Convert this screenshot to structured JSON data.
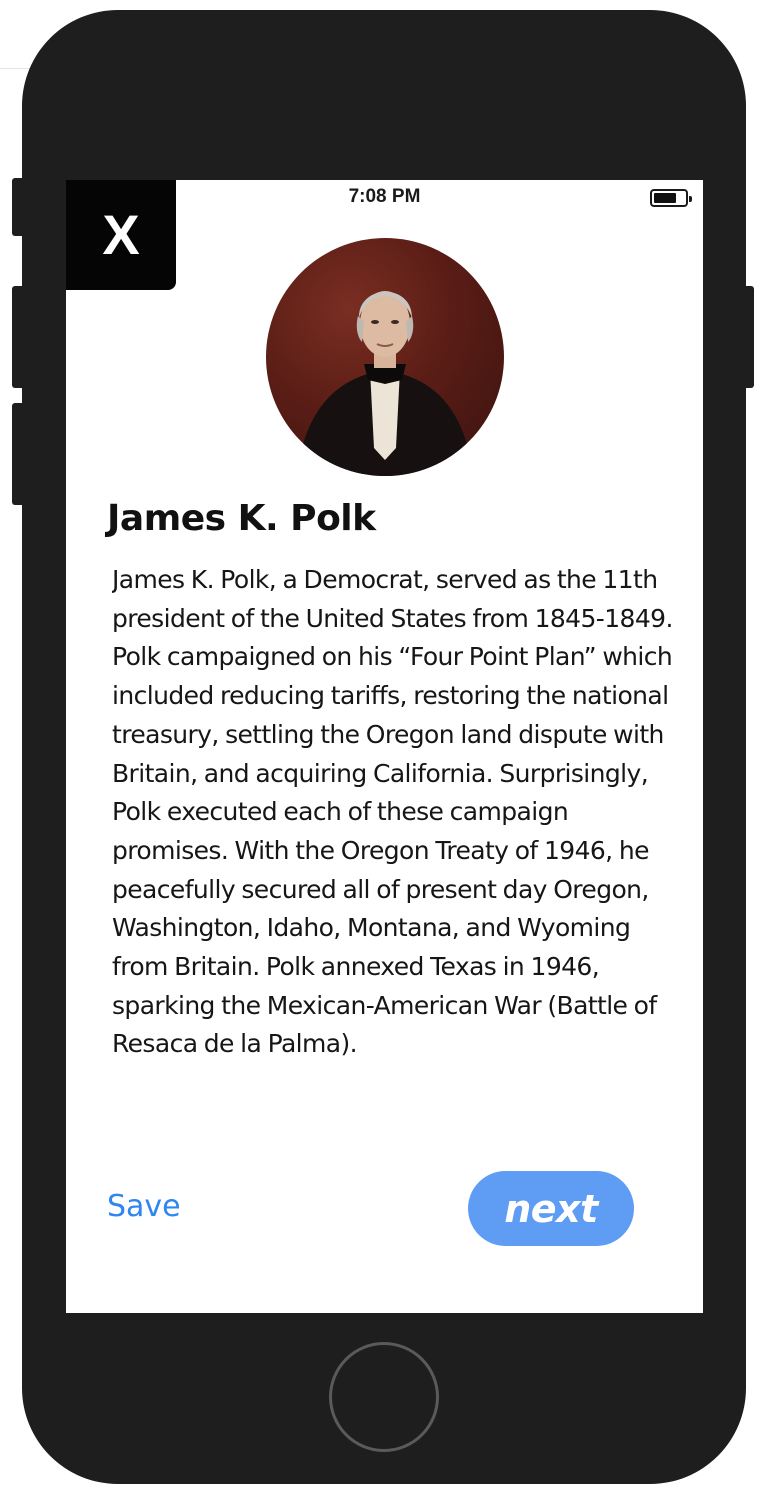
{
  "status_bar": {
    "time": "7:08 PM",
    "battery_icon": "battery-icon"
  },
  "close_button": {
    "label": "X"
  },
  "profile": {
    "portrait_icon": "portrait-image",
    "name": "James K. Polk",
    "bio": "James K. Polk, a Democrat, served as the 11th president of the United States from 1845-1849. Polk campaigned on his “Four Point Plan” which included reducing tariffs, restoring the national treasury, settling the Oregon land dispute with Britain, and acquiring California. Surprisingly, Polk executed each of these campaign promises. With the Oregon Treaty of 1946, he peacefully secured all of present day Oregon, Washington, Idaho, Montana, and Wyoming from Britain. Polk annexed Texas in 1946, sparking the Mexican-American War (Battle of Resaca de la Palma)."
  },
  "actions": {
    "save_label": "Save",
    "next_label": "next"
  },
  "colors": {
    "accent_link": "#2f86f0",
    "next_button_bg": "#5f9cf4",
    "device_body": "#1e1e1e"
  }
}
